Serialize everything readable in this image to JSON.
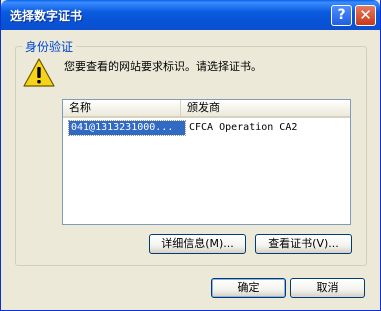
{
  "window": {
    "title": "选择数字证书"
  },
  "titlebar": {
    "help_label": "?",
    "close_label": "✕"
  },
  "group": {
    "label": "身份验证"
  },
  "message": "您要查看的网站要求标识。请选择证书。",
  "list": {
    "columns": [
      "名称",
      "颁发商"
    ],
    "rows": [
      {
        "name": "041@1313231000...",
        "issuer": "CFCA Operation CA2"
      }
    ]
  },
  "buttons": {
    "details": "详细信息(M)...",
    "view_cert": "查看证书(V)...",
    "ok": "确定",
    "cancel": "取消"
  },
  "colors": {
    "title_bar": "#0a5bdf",
    "selection": "#316ac5",
    "group_label": "#0046d5",
    "dialog_bg": "#ece9d8"
  },
  "icons": {
    "warning": "warning-icon",
    "help": "help-icon",
    "close": "close-icon"
  }
}
